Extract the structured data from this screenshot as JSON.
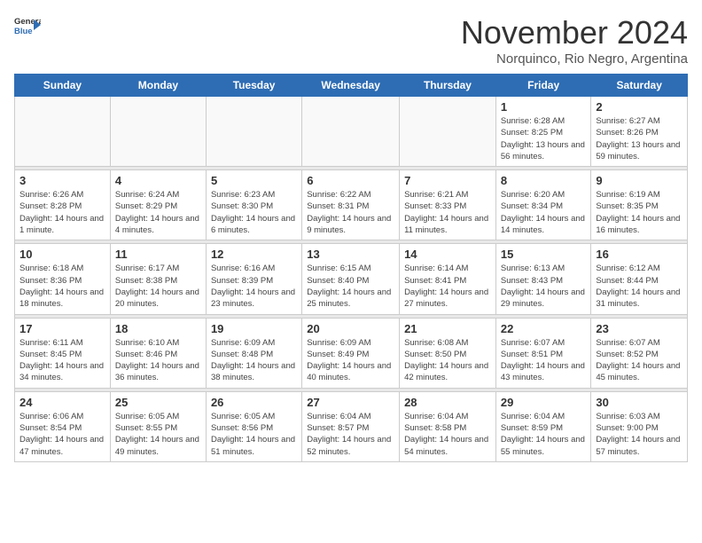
{
  "header": {
    "logo_general": "General",
    "logo_blue": "Blue",
    "month_title": "November 2024",
    "location": "Norquinco, Rio Negro, Argentina"
  },
  "days_of_week": [
    "Sunday",
    "Monday",
    "Tuesday",
    "Wednesday",
    "Thursday",
    "Friday",
    "Saturday"
  ],
  "weeks": [
    [
      {
        "day": "",
        "info": ""
      },
      {
        "day": "",
        "info": ""
      },
      {
        "day": "",
        "info": ""
      },
      {
        "day": "",
        "info": ""
      },
      {
        "day": "",
        "info": ""
      },
      {
        "day": "1",
        "info": "Sunrise: 6:28 AM\nSunset: 8:25 PM\nDaylight: 13 hours and 56 minutes."
      },
      {
        "day": "2",
        "info": "Sunrise: 6:27 AM\nSunset: 8:26 PM\nDaylight: 13 hours and 59 minutes."
      }
    ],
    [
      {
        "day": "3",
        "info": "Sunrise: 6:26 AM\nSunset: 8:28 PM\nDaylight: 14 hours and 1 minute."
      },
      {
        "day": "4",
        "info": "Sunrise: 6:24 AM\nSunset: 8:29 PM\nDaylight: 14 hours and 4 minutes."
      },
      {
        "day": "5",
        "info": "Sunrise: 6:23 AM\nSunset: 8:30 PM\nDaylight: 14 hours and 6 minutes."
      },
      {
        "day": "6",
        "info": "Sunrise: 6:22 AM\nSunset: 8:31 PM\nDaylight: 14 hours and 9 minutes."
      },
      {
        "day": "7",
        "info": "Sunrise: 6:21 AM\nSunset: 8:33 PM\nDaylight: 14 hours and 11 minutes."
      },
      {
        "day": "8",
        "info": "Sunrise: 6:20 AM\nSunset: 8:34 PM\nDaylight: 14 hours and 14 minutes."
      },
      {
        "day": "9",
        "info": "Sunrise: 6:19 AM\nSunset: 8:35 PM\nDaylight: 14 hours and 16 minutes."
      }
    ],
    [
      {
        "day": "10",
        "info": "Sunrise: 6:18 AM\nSunset: 8:36 PM\nDaylight: 14 hours and 18 minutes."
      },
      {
        "day": "11",
        "info": "Sunrise: 6:17 AM\nSunset: 8:38 PM\nDaylight: 14 hours and 20 minutes."
      },
      {
        "day": "12",
        "info": "Sunrise: 6:16 AM\nSunset: 8:39 PM\nDaylight: 14 hours and 23 minutes."
      },
      {
        "day": "13",
        "info": "Sunrise: 6:15 AM\nSunset: 8:40 PM\nDaylight: 14 hours and 25 minutes."
      },
      {
        "day": "14",
        "info": "Sunrise: 6:14 AM\nSunset: 8:41 PM\nDaylight: 14 hours and 27 minutes."
      },
      {
        "day": "15",
        "info": "Sunrise: 6:13 AM\nSunset: 8:43 PM\nDaylight: 14 hours and 29 minutes."
      },
      {
        "day": "16",
        "info": "Sunrise: 6:12 AM\nSunset: 8:44 PM\nDaylight: 14 hours and 31 minutes."
      }
    ],
    [
      {
        "day": "17",
        "info": "Sunrise: 6:11 AM\nSunset: 8:45 PM\nDaylight: 14 hours and 34 minutes."
      },
      {
        "day": "18",
        "info": "Sunrise: 6:10 AM\nSunset: 8:46 PM\nDaylight: 14 hours and 36 minutes."
      },
      {
        "day": "19",
        "info": "Sunrise: 6:09 AM\nSunset: 8:48 PM\nDaylight: 14 hours and 38 minutes."
      },
      {
        "day": "20",
        "info": "Sunrise: 6:09 AM\nSunset: 8:49 PM\nDaylight: 14 hours and 40 minutes."
      },
      {
        "day": "21",
        "info": "Sunrise: 6:08 AM\nSunset: 8:50 PM\nDaylight: 14 hours and 42 minutes."
      },
      {
        "day": "22",
        "info": "Sunrise: 6:07 AM\nSunset: 8:51 PM\nDaylight: 14 hours and 43 minutes."
      },
      {
        "day": "23",
        "info": "Sunrise: 6:07 AM\nSunset: 8:52 PM\nDaylight: 14 hours and 45 minutes."
      }
    ],
    [
      {
        "day": "24",
        "info": "Sunrise: 6:06 AM\nSunset: 8:54 PM\nDaylight: 14 hours and 47 minutes."
      },
      {
        "day": "25",
        "info": "Sunrise: 6:05 AM\nSunset: 8:55 PM\nDaylight: 14 hours and 49 minutes."
      },
      {
        "day": "26",
        "info": "Sunrise: 6:05 AM\nSunset: 8:56 PM\nDaylight: 14 hours and 51 minutes."
      },
      {
        "day": "27",
        "info": "Sunrise: 6:04 AM\nSunset: 8:57 PM\nDaylight: 14 hours and 52 minutes."
      },
      {
        "day": "28",
        "info": "Sunrise: 6:04 AM\nSunset: 8:58 PM\nDaylight: 14 hours and 54 minutes."
      },
      {
        "day": "29",
        "info": "Sunrise: 6:04 AM\nSunset: 8:59 PM\nDaylight: 14 hours and 55 minutes."
      },
      {
        "day": "30",
        "info": "Sunrise: 6:03 AM\nSunset: 9:00 PM\nDaylight: 14 hours and 57 minutes."
      }
    ]
  ]
}
